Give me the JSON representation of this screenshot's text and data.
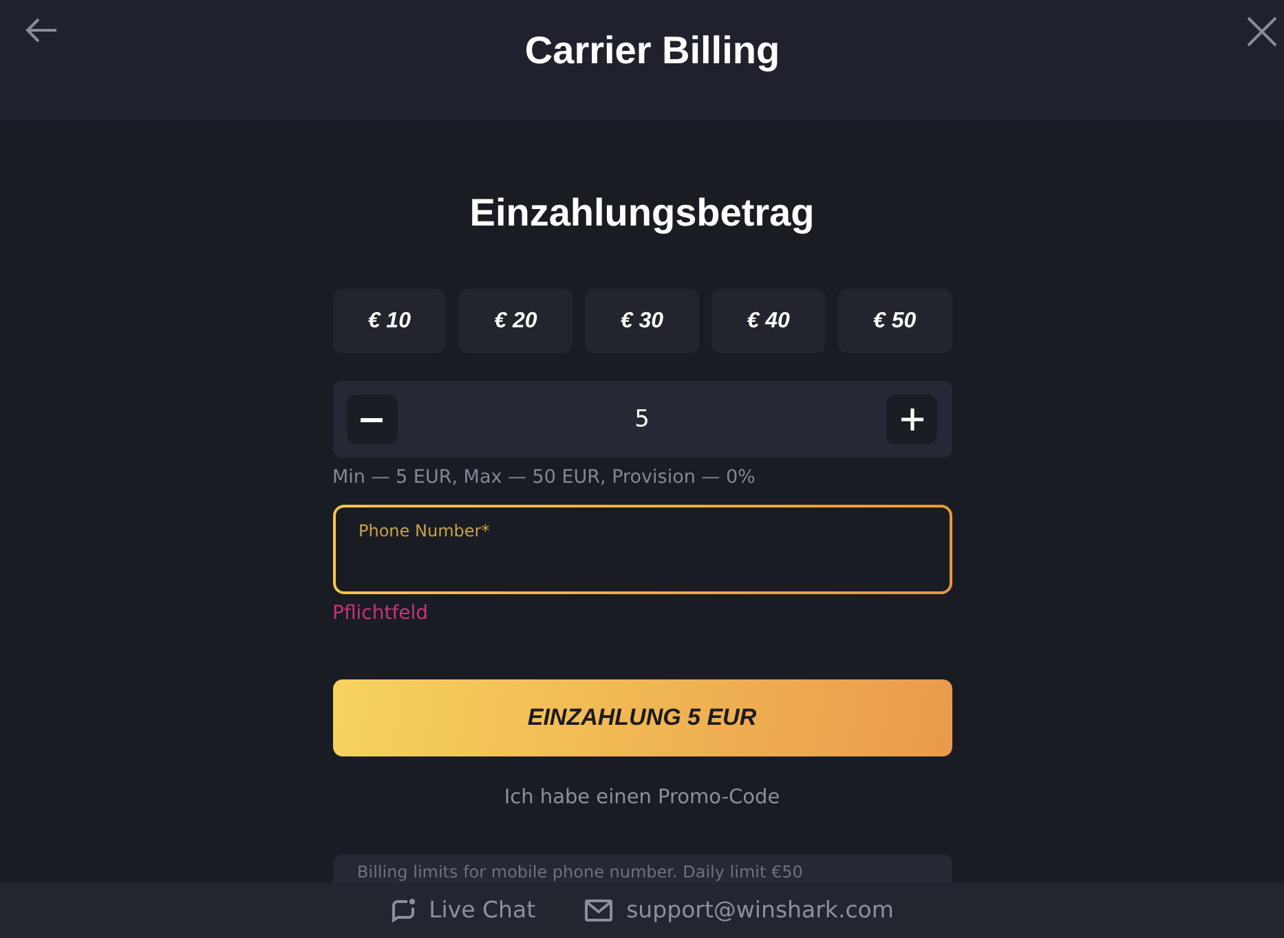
{
  "header": {
    "title": "Carrier Billing"
  },
  "section_title": "Einzahlungsbetrag",
  "amount_presets": [
    {
      "label": "€ 10",
      "selected": false
    },
    {
      "label": "€ 20",
      "selected": false
    },
    {
      "label": "€ 30",
      "selected": false
    },
    {
      "label": "€ 40",
      "selected": false
    },
    {
      "label": "€ 50",
      "selected": false
    }
  ],
  "amount_stepper": {
    "value": "5"
  },
  "limits_hint": "Min — 5 EUR, Max — 50 EUR, Provision — 0%",
  "phone_field": {
    "label": "Phone Number*",
    "focused": true,
    "error": "Pflichtfeld"
  },
  "deposit_button": {
    "label": "EINZAHLUNG 5 EUR"
  },
  "promo_link": "Ich habe einen Promo-Code",
  "info_note": "Billing limits for mobile phone number. Daily limit €50",
  "footer": {
    "links": [
      {
        "kind": "chat",
        "label": "Live Chat"
      },
      {
        "kind": "email",
        "label": "support@winshark.com"
      }
    ]
  }
}
